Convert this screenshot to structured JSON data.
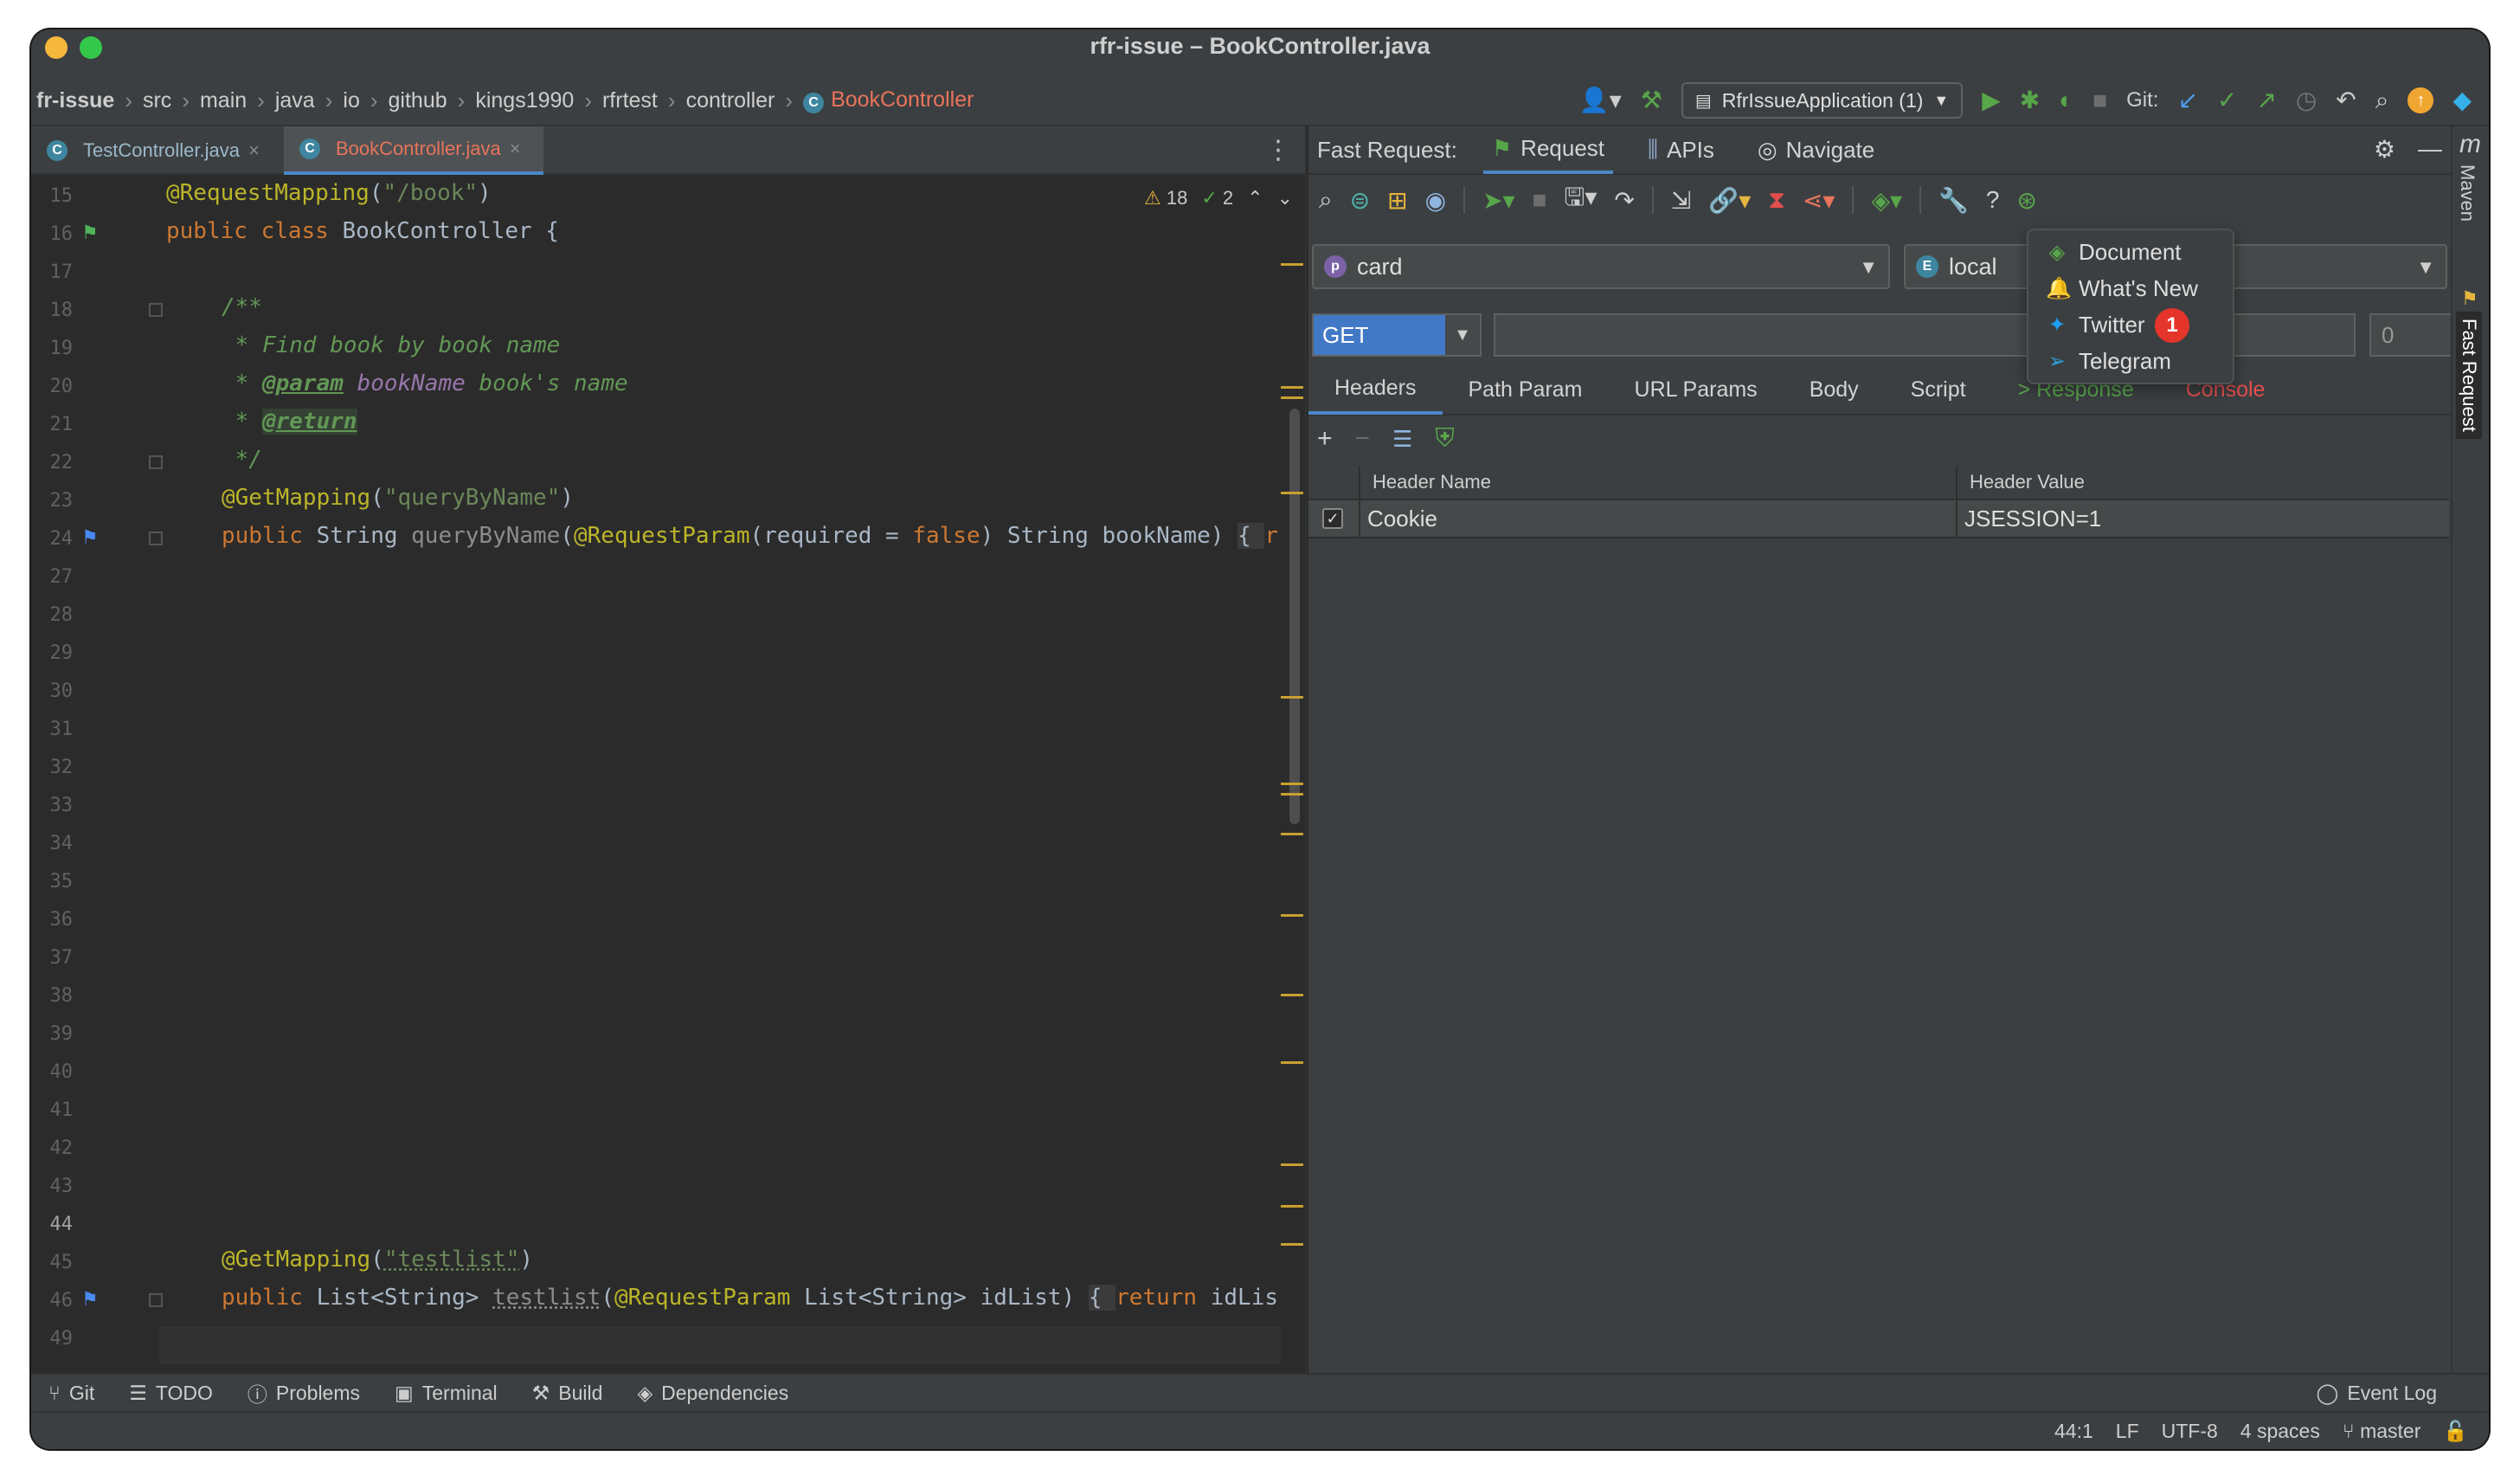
{
  "window": {
    "title": "rfr-issue – BookController.java"
  },
  "breadcrumbs": [
    "fr-issue",
    "src",
    "main",
    "java",
    "io",
    "github",
    "kings1990",
    "rfrtest",
    "controller",
    "BookController"
  ],
  "toolbar": {
    "run_config": "RfrIssueApplication (1)",
    "git_label": "Git:"
  },
  "editor": {
    "tabs": [
      {
        "label": "TestController.java",
        "active": false
      },
      {
        "label": "BookController.java",
        "active": true
      }
    ],
    "inspection": {
      "warnings": "18",
      "checks": "2"
    },
    "line_numbers": [
      "15",
      "16",
      "17",
      "18",
      "19",
      "20",
      "21",
      "22",
      "23",
      "24",
      "27",
      "28",
      "29",
      "30",
      "31",
      "32",
      "33",
      "34",
      "35",
      "36",
      "37",
      "38",
      "39",
      "40",
      "41",
      "42",
      "43",
      "44",
      "45",
      "46",
      "49"
    ],
    "code": {
      "l15_annot": "@RequestMapping",
      "l15_paren": "(",
      "l15_str": "\"/book\"",
      "l15_close": ")",
      "l16_kw": "public class ",
      "l16_rest": "BookController {",
      "l18": "/**",
      "l19": " * Find book by book name",
      "l20_star": " * ",
      "l20_tag": "@param",
      "l20_param": " bookName",
      "l20_rest": " book's name",
      "l21_star": " * ",
      "l21_tag": "@return",
      "l22": " */",
      "l23_annot": "@GetMapping",
      "l23_paren": "(",
      "l23_str": "\"queryByName\"",
      "l23_close": ")",
      "l24_kw": "public ",
      "l24_type": "String ",
      "l24_meth": "queryByName",
      "l24_paren": "(",
      "l24_annot": "@RequestParam",
      "l24_args": "(required = ",
      "l24_false": "false",
      "l24_rest": ") String bookName) ",
      "l24_brace": "{ ",
      "l24_tail": "r",
      "l45_annot": "@GetMapping",
      "l45_paren": "(",
      "l45_str": "\"testlist\"",
      "l45_close": ")",
      "l46_kw": "public ",
      "l46_type": "List<String> ",
      "l46_meth": "testlist",
      "l46_paren": "(",
      "l46_annot": "@RequestParam",
      "l46_rest": " List<String> idList) ",
      "l46_brace": "{ ",
      "l46_ret": "return ",
      "l46_tail": "idLis"
    }
  },
  "fast_request": {
    "title": "Fast Request:",
    "tabs": [
      "Request",
      "APIs",
      "Navigate"
    ],
    "project_combo": {
      "badge": "p",
      "value": "card"
    },
    "env_combo": {
      "badge": "E",
      "value": "local"
    },
    "method": "GET",
    "url": "",
    "count_value": "0",
    "subtabs": [
      "Headers",
      "Path Param",
      "URL Params",
      "Body",
      "Script",
      "> Response",
      "Console"
    ],
    "table": {
      "columns": [
        "Header Name",
        "Header Value"
      ],
      "rows": [
        {
          "checked": true,
          "name": "Cookie",
          "value": "JSESSION=1"
        }
      ]
    },
    "help_menu": {
      "items": [
        "Document",
        "What's New",
        "Twitter",
        "Telegram"
      ],
      "badge": "1"
    }
  },
  "side_tabs": {
    "maven_icon": "m",
    "maven": "Maven",
    "fast_request": "Fast Request"
  },
  "tool_windows": [
    "Git",
    "TODO",
    "Problems",
    "Terminal",
    "Build",
    "Dependencies"
  ],
  "event_log": "Event Log",
  "status": {
    "position": "44:1",
    "line_sep": "LF",
    "encoding": "UTF-8",
    "indent": "4 spaces",
    "branch": "master"
  },
  "colors": {
    "accent": "#4a88c7",
    "annotation": "#bbb529",
    "string": "#6a8759",
    "keyword": "#cc7832",
    "error_badge": "#e5342a"
  }
}
